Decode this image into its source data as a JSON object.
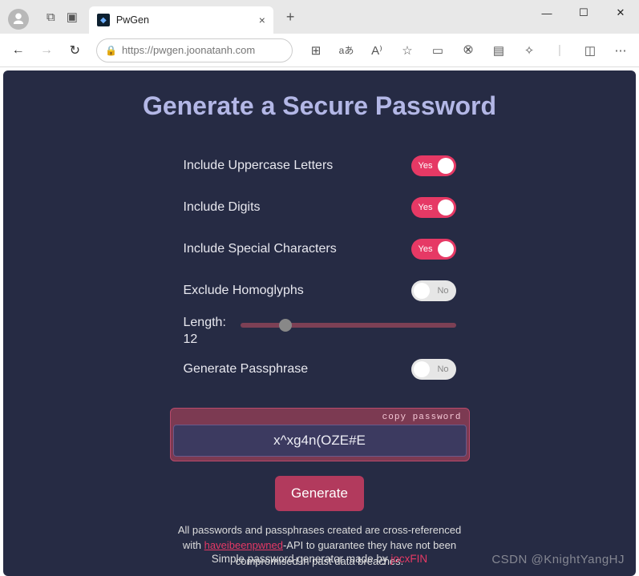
{
  "browser": {
    "tab_title": "PwGen",
    "url": "https://pwgen.joonatanh.com",
    "new_tab": "+",
    "close_tab": "×",
    "win_min": "—",
    "win_max": "☐",
    "win_close": "✕",
    "back": "←",
    "forward": "→",
    "reload": "↻",
    "more": "⋯"
  },
  "app": {
    "title": "Generate a Secure Password",
    "options": {
      "uppercase": {
        "label": "Include Uppercase Letters",
        "state": "Yes"
      },
      "digits": {
        "label": "Include Digits",
        "state": "Yes"
      },
      "special": {
        "label": "Include Special Characters",
        "state": "Yes"
      },
      "homoglyphs": {
        "label": "Exclude Homoglyphs",
        "state": "No"
      },
      "passphrase": {
        "label": "Generate Passphrase",
        "state": "No"
      }
    },
    "length": {
      "label": "Length:",
      "value": "12"
    },
    "password": {
      "copy_label": "copy password",
      "value": "x^xg4n(OZE#E"
    },
    "generate_label": "Generate",
    "note": {
      "pre": "All passwords and passphrases created are cross-referenced with ",
      "link": "haveibeenpwned",
      "post": "-API to guarantee they have not been compromised in past data breaches."
    },
    "footer": {
      "text": "Simple password generator made by ",
      "author": "jocxFIN"
    }
  },
  "watermark": "CSDN @KnightYangHJ"
}
